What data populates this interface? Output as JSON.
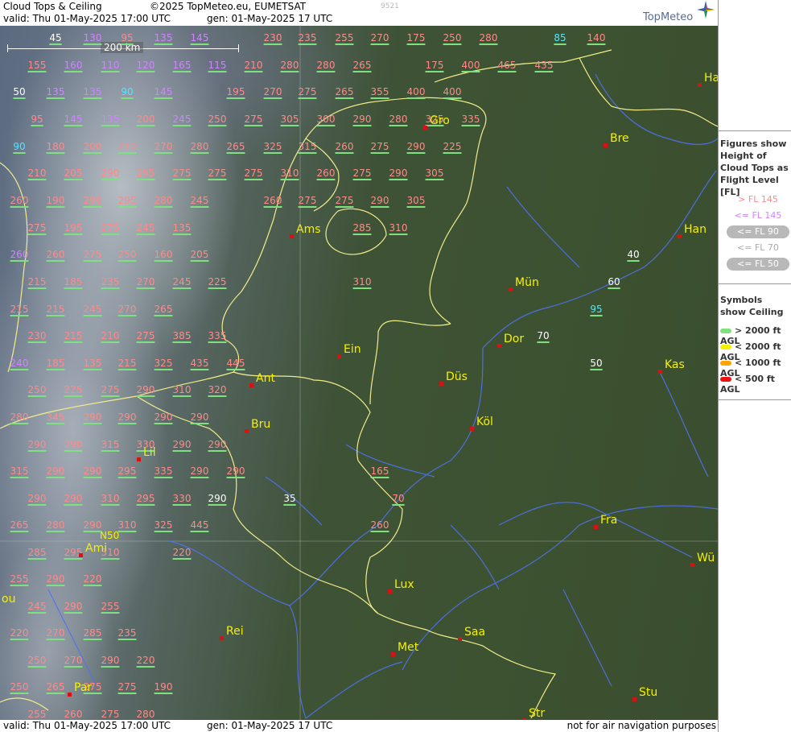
{
  "header": {
    "title": "Cloud Tops & Ceiling",
    "copyright": "©2025 TopMeteo.eu, EUMETSAT",
    "image_number": "9521",
    "valid": "valid:  Thu  01-May-2025  17:00 UTC",
    "generated": "gen: 01-May-2025 17 UTC",
    "logo": "TopMeteo"
  },
  "footer": {
    "valid": "valid:  Thu  01-May-2025  17:00 UTC",
    "generated": "gen: 01-May-2025 17 UTC",
    "disclaimer": "not for air navigation purposes"
  },
  "map": {
    "scale_label": "200 km",
    "gridline_label": "N50",
    "cities": [
      "Gro",
      "Bre",
      "Ha",
      "Ams",
      "Han",
      "Mün",
      "Ein",
      "Dor",
      "Kas",
      "Ant",
      "Düs",
      "Köl",
      "Bru",
      "Lil",
      "Fra",
      "Ami",
      "Wü",
      "Lux",
      "Rei",
      "Saa",
      "Met",
      "Par",
      "Stu",
      "Str",
      "ou"
    ],
    "flight_levels": [
      "45",
      "130",
      "95",
      "135",
      "145",
      "230",
      "235",
      "255",
      "270",
      "175",
      "250",
      "280",
      "85",
      "140",
      "155",
      "160",
      "110",
      "120",
      "165",
      "115",
      "210",
      "280",
      "280",
      "265",
      "175",
      "400",
      "465",
      "435",
      "50",
      "135",
      "135",
      "90",
      "145",
      "195",
      "270",
      "275",
      "265",
      "355",
      "400",
      "400",
      "95",
      "145",
      "135",
      "200",
      "245",
      "250",
      "275",
      "305",
      "300",
      "290",
      "280",
      "325",
      "335",
      "90",
      "180",
      "200",
      "210",
      "270",
      "280",
      "265",
      "325",
      "315",
      "260",
      "275",
      "290",
      "225",
      "210",
      "205",
      "290",
      "295",
      "275",
      "275",
      "275",
      "310",
      "260",
      "275",
      "290",
      "305",
      "260",
      "190",
      "290",
      "295",
      "280",
      "245",
      "260",
      "275",
      "275",
      "290",
      "305",
      "275",
      "195",
      "275",
      "245",
      "135",
      "285",
      "310",
      "260",
      "260",
      "275",
      "250",
      "160",
      "205",
      "40",
      "215",
      "185",
      "235",
      "270",
      "245",
      "225",
      "310",
      "60",
      "215",
      "215",
      "245",
      "270",
      "265",
      "95",
      "230",
      "215",
      "210",
      "275",
      "385",
      "335",
      "70",
      "240",
      "185",
      "135",
      "215",
      "325",
      "435",
      "445",
      "50",
      "250",
      "225",
      "275",
      "290",
      "310",
      "320",
      "280",
      "345",
      "290",
      "290",
      "290",
      "290",
      "290",
      "290",
      "315",
      "330",
      "290",
      "290",
      "315",
      "290",
      "290",
      "295",
      "335",
      "290",
      "290",
      "165",
      "290",
      "290",
      "310",
      "295",
      "330",
      "290",
      "35",
      "70",
      "265",
      "280",
      "290",
      "310",
      "325",
      "445",
      "260",
      "285",
      "295",
      "310",
      "220",
      "255",
      "290",
      "220",
      "245",
      "290",
      "255",
      "220",
      "270",
      "285",
      "235",
      "250",
      "270",
      "290",
      "220",
      "250",
      "265",
      "275",
      "275",
      "190",
      "255",
      "260",
      "275",
      "280"
    ]
  },
  "legend": {
    "heading": "Figures show Height of Cloud Tops as Flight Level  [FL]",
    "levels": [
      {
        "label": "> FL 145",
        "color": "#ff8a8a"
      },
      {
        "label": "<= FL 145",
        "color": "#d084ff"
      },
      {
        "label": "<= FL 90",
        "color": "#4fe7ff"
      },
      {
        "label": "<= FL 70",
        "color": "#aaaaaa"
      },
      {
        "label": "<= FL 50",
        "color": "#ffffff"
      }
    ],
    "symbols_heading": "Symbols show Ceiling",
    "symbols": [
      {
        "label": "> 2000 ft AGL",
        "color": "#7fe07f"
      },
      {
        "label": "< 2000 ft AGL",
        "color": "#f5f000"
      },
      {
        "label": "< 1000 ft AGL",
        "color": "#ffa500"
      },
      {
        "label": "< 500 ft AGL",
        "color": "#ee1111"
      }
    ]
  }
}
